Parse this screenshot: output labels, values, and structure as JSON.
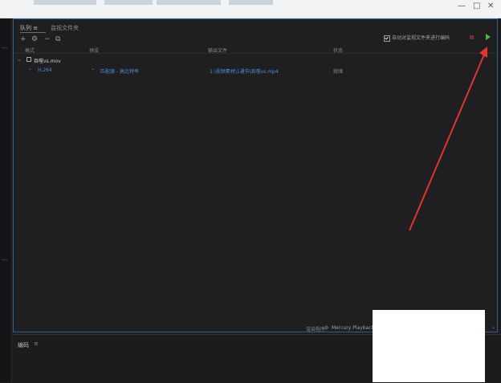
{
  "queue": {
    "tabs": [
      "队列 ≡",
      "监视文件夹"
    ],
    "toolbar": {
      "add": "+",
      "settings": "⚙",
      "remove": "−",
      "duplicate": "⧉"
    },
    "auto_encode": {
      "label": "自动对监视文件夹进行编码",
      "checked": true
    },
    "columns": {
      "format": "格式",
      "preset": "预设",
      "output": "输出文件",
      "status": "状态"
    },
    "source": {
      "name": "吞噬vs.mov"
    },
    "job": {
      "format": "H.264",
      "preset": "匹配源 - 高比特率",
      "output": "1.\\视频素材\\1通节\\吞噬vs.mp4",
      "status": "就绪"
    },
    "renderer": {
      "label": "渲染程序:",
      "value": "Mercury Playback"
    }
  },
  "encode_panel": {
    "title": "编码",
    "menu": "≡"
  },
  "colors": {
    "accent": "#4d8ed0",
    "start": "#3fbf47",
    "arrow": "#e0352b",
    "border": "#2e5f8f"
  }
}
